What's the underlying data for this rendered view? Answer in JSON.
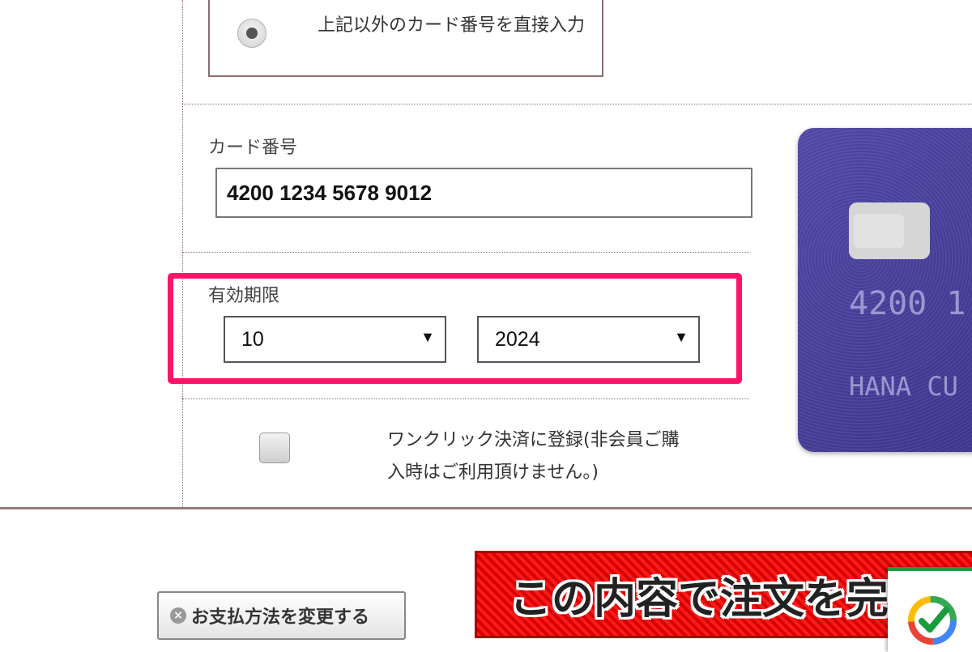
{
  "payment_option": {
    "label": "上記以外のカード番号を直接入力",
    "selected": true
  },
  "card_number": {
    "label": "カード番号",
    "value": "4200 1234 5678 9012"
  },
  "expiry": {
    "label": "有効期限",
    "month": "10",
    "year": "2024"
  },
  "one_click": {
    "label": "ワンクリック決済に登録(非会員ご購入時はご利用頂けません。)",
    "checked": false
  },
  "card_visual": {
    "number_preview": "4200 1",
    "name_preview": "HANA CU"
  },
  "buttons": {
    "change_payment": "お支払方法を変更する",
    "confirm_order": "この内容で注文を完"
  },
  "colors": {
    "highlight": "#ff1469",
    "order_button": "#e60000",
    "card_background": "#4a43a0"
  },
  "icons": [
    "radio-selected-icon",
    "dropdown-arrow-icon",
    "close-circle-icon",
    "verified-check-icon"
  ]
}
